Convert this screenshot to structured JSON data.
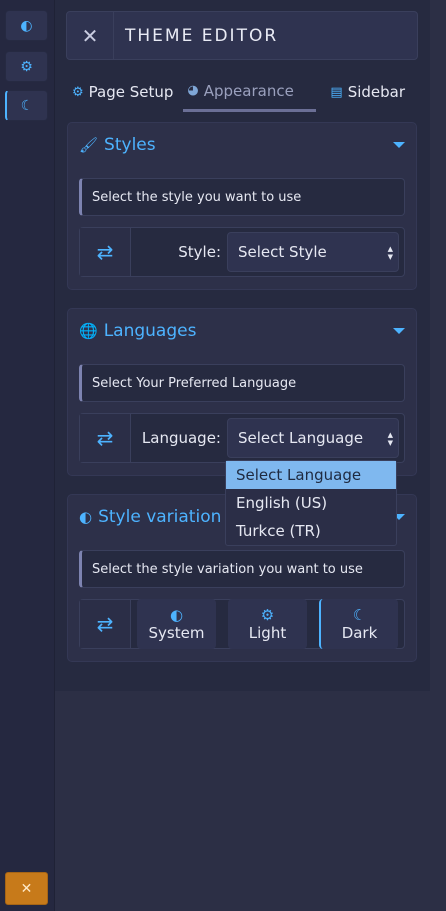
{
  "rail": {
    "buttons": [
      {
        "icon": "half-circle-icon",
        "glyph": "◐"
      },
      {
        "icon": "gear-icon",
        "glyph": "⚙"
      },
      {
        "icon": "moon-icon",
        "glyph": "☾"
      }
    ],
    "close_glyph": "✕"
  },
  "header": {
    "close_glyph": "✕",
    "title": "THEME EDITOR"
  },
  "tabs": [
    {
      "label": "Page Setup",
      "glyph": "⚙"
    },
    {
      "label": "Appearance",
      "glyph": "◕"
    },
    {
      "label": "Sidebar",
      "glyph": "▤"
    }
  ],
  "styles": {
    "title": "Styles",
    "description": "Select the style you want to use",
    "label": "Style:",
    "selected": "Select Style"
  },
  "languages": {
    "title": "Languages",
    "description": "Select Your Preferred Language",
    "label": "Language:",
    "selected": "Select Language",
    "options": [
      "Select Language",
      "English (US)",
      "Turkce (TR)"
    ]
  },
  "variation": {
    "title": "Style variation",
    "description": "Select the style variation you want to use",
    "options": [
      {
        "label": "System",
        "glyph": "◐"
      },
      {
        "label": "Light",
        "glyph": "⚙"
      },
      {
        "label": "Dark",
        "glyph": "☾"
      }
    ]
  },
  "colors": {
    "accent": "#4db3ff",
    "close_bg": "#c77a1a"
  }
}
